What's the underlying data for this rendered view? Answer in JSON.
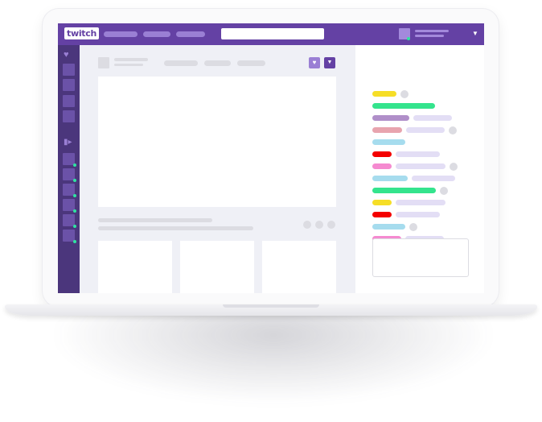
{
  "brand": {
    "logo_text": "twitch",
    "primary": "#6441a4",
    "sidebar": "#4b367c",
    "accent_light": "#9a7fd4",
    "live_green": "#2ee4a0",
    "placeholder_gray": "#dcdce2"
  },
  "topnav": {
    "nav_items": 3,
    "search_field": "empty",
    "user_menu_icon": "chevron-down-icon"
  },
  "sidebar": {
    "section_icons": [
      "heart-icon",
      "video-camera-icon"
    ],
    "followed_channels": 4,
    "live_channels": 6
  },
  "main": {
    "action_icons": [
      "heart-icon",
      "chevron-down-icon"
    ],
    "tabs": 3,
    "option_dots": 3,
    "thumbnail_cards": 3
  },
  "chat": {
    "message_colors": [
      "#f6de27",
      "#34e48d",
      "#b08fc9",
      "#e8a4ae",
      "#a6dcee",
      "#f40000",
      "#f58ad0",
      "#a6dcee",
      "#34e48d",
      "#f6de27",
      "#f40000",
      "#a6dcee",
      "#f58ad0",
      "#b08fc9"
    ]
  }
}
